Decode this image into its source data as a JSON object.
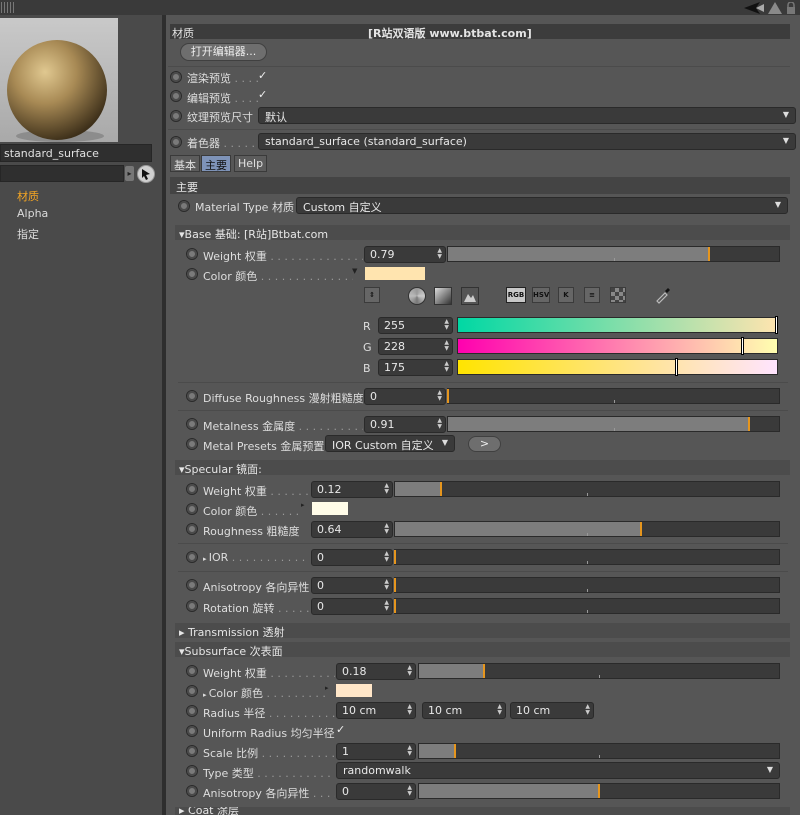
{
  "window": {
    "header_title": "材质",
    "header_center": "[R站双语版 www.btbat.com]"
  },
  "left_panel": {
    "material_name": "standard_surface",
    "nav": [
      {
        "label": "材质",
        "active": true
      },
      {
        "label": "Alpha",
        "active": false
      },
      {
        "label": "指定",
        "active": false
      }
    ]
  },
  "top": {
    "open_editor": "打开编辑器...",
    "render_preview": "渲染预览",
    "editor_preview": "编辑预览",
    "texture_preview_size": "纹理预览尺寸",
    "texture_preview_value": "默认",
    "shader_label": "着色器",
    "shader_value": "standard_surface (standard_surface)",
    "check": "✓",
    "dots4": ". . . .",
    "dots6": ". . . . . ."
  },
  "tabs": [
    {
      "label": "基本",
      "selected": false
    },
    {
      "label": "主要",
      "selected": true
    },
    {
      "label": "Help",
      "selected": false
    }
  ],
  "section_main": "主要",
  "material_type": {
    "label": "Material Type 材质",
    "value": "Custom 自定义"
  },
  "base": {
    "title": "Base 基础: [R站]Btbat.com",
    "weight": {
      "label": "Weight 权重",
      "dots": ". . . . . . . . . . . . . . .",
      "value": "0.79",
      "fraction": 0.79
    },
    "color": {
      "label": "Color 颜色",
      "dots": ". . . . . . . . . . . . . .",
      "hex": "#ffe4af"
    },
    "color_tools": [
      "RGB",
      "HSV",
      "K"
    ],
    "rgb": [
      {
        "channel": "R",
        "value": "255",
        "fraction": 1.0
      },
      {
        "channel": "G",
        "value": "228",
        "fraction": 0.894
      },
      {
        "channel": "B",
        "value": "175",
        "fraction": 0.686
      }
    ],
    "diffuse_roughness": {
      "label": "Diffuse Roughness 漫射粗糙度",
      "value": "0",
      "fraction": 0
    },
    "metalness": {
      "label": "Metalness 金属度",
      "dots": ". . . . . . . . . . .",
      "value": "0.91",
      "fraction": 0.91
    },
    "metal_presets": {
      "label": "Metal Presets 金属预置",
      "value": "IOR Custom 自定义",
      "button": ">"
    }
  },
  "specular": {
    "title": "Specular 镜面:",
    "weight": {
      "label": "Weight 权重",
      "dots": ". . . . . . .",
      "value": "0.12",
      "fraction": 0.12
    },
    "color": {
      "label": "Color 颜色",
      "dots": ". . . . . .",
      "hex": "#fffce8"
    },
    "roughness": {
      "label": "Roughness 粗糙度",
      "value": "0.64",
      "fraction": 0.64
    },
    "ior": {
      "label": "IOR",
      "dots": ". . . . . . . . . . .",
      "value": "0",
      "fraction": 0
    },
    "anisotropy": {
      "label": "Anisotropy 各向异性",
      "value": "0",
      "fraction": 0
    },
    "rotation": {
      "label": "Rotation 旋转",
      "dots": ". . . . . .",
      "value": "0",
      "fraction": 0
    }
  },
  "transmission": {
    "title": "Transmission 透射"
  },
  "subsurface": {
    "title": "Subsurface 次表面",
    "weight": {
      "label": "Weight 权重",
      "dots": ". . . . . . . . . . .",
      "value": "0.18",
      "fraction": 0.18
    },
    "color": {
      "label": "Color 颜色",
      "dots": ". . . . . . . . .",
      "hex": "#ffe6c8"
    },
    "radius": {
      "label": "Radius 半径",
      "dots": ". . . . . . . . . . . .",
      "values": [
        "10 cm",
        "10 cm",
        "10 cm"
      ]
    },
    "uniform_radius": {
      "label": "Uniform Radius 均匀半径"
    },
    "scale": {
      "label": "Scale 比例",
      "dots": ". . . . . . . . . . . . .",
      "value": "1",
      "fraction": 0.1
    },
    "type": {
      "label": "Type 类型",
      "dots": ". . . . . . . . . . . . . .",
      "value": "randomwalk"
    },
    "anisotropy": {
      "label": "Anisotropy 各向异性",
      "dots": ". . . .",
      "value": "0",
      "fraction": 0.5
    }
  },
  "coat": {
    "title": "Coat 涂层"
  },
  "colors": {
    "accent": "#e6961e",
    "panel": "#565656",
    "dark": "#3a3a3a",
    "tab_selected": "#7e93b8"
  }
}
